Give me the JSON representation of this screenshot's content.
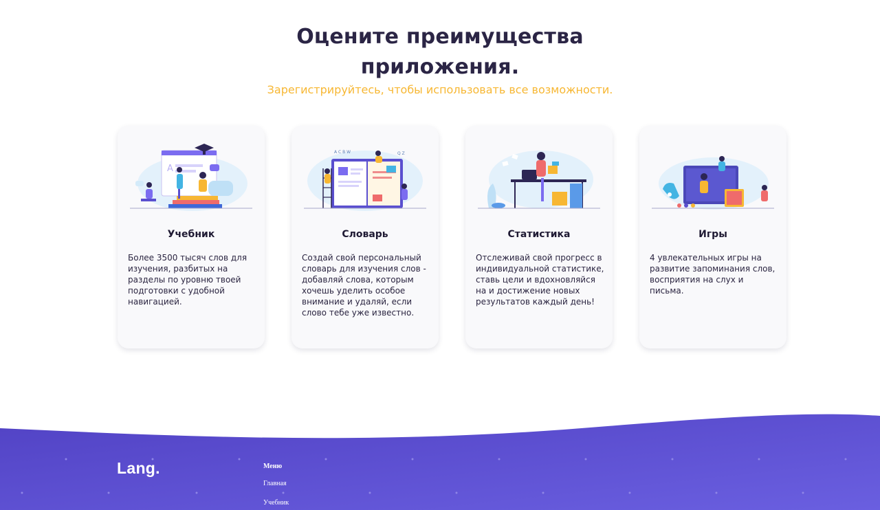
{
  "header": {
    "title": "Оцените преимущества приложения.",
    "subtitle": "Зарегистрируйтесь, чтобы использовать все возможности."
  },
  "features": [
    {
      "title": "Учебник",
      "description": "Более 3500 тысяч слов для изучения, разбитых на разделы по уровню твоей подготовки с удобной навигацией.",
      "illustration": "students-studying-illustration"
    },
    {
      "title": "Словарь",
      "description": "Создай свой персональный словарь для изучения слов - добавляй слова, которым хочешь уделить особое внимание и удаляй, если слово тебе уже известно.",
      "illustration": "dictionary-book-illustration"
    },
    {
      "title": "Статистика",
      "description": "Отслеживай свой прогресс в индивидуальной статистике, ставь цели и вдохновляйся на и достижение новых результатов каждый день!",
      "illustration": "desk-workspace-illustration"
    },
    {
      "title": "Игры",
      "description": "4 увлекательных игры на развитие запоминания слов, восприятия на слух и письма.",
      "illustration": "games-screen-illustration"
    }
  ],
  "footer": {
    "logo": "Lang.",
    "menu_title": "Меню",
    "menu_items": [
      "Главная",
      "Учебник"
    ]
  },
  "colors": {
    "title": "#2b2545",
    "accent_yellow": "#f7b733",
    "footer_purple": "#5b4fcf",
    "card_bg": "#f9f9fb"
  }
}
